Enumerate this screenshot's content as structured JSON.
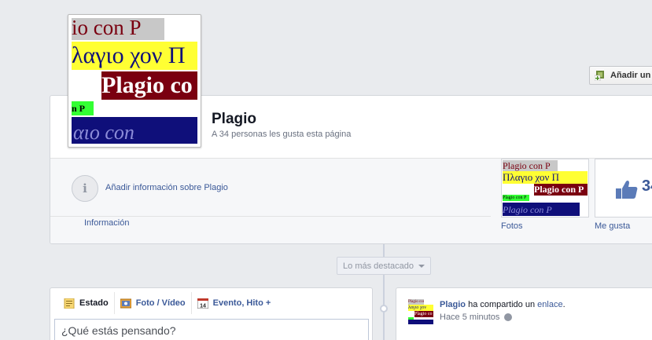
{
  "header": {
    "add_button_label": "Añadir un",
    "page_name": "Plagio",
    "likes_line": "A 34 personas les gusta esta página"
  },
  "profile_image": {
    "lines": [
      "io con P",
      "λαγιο χον Π",
      "Plagio co",
      "n P",
      "αιο con"
    ]
  },
  "info": {
    "add_info_link": "Añadir información sobre Plagio",
    "label": "Información"
  },
  "photos": {
    "label": "Fotos",
    "thumb_lines": [
      "Plagio con P",
      "Πλαγιο χον Π",
      "Plagio con P",
      "Plagio con P",
      "Plagio con P"
    ]
  },
  "likes": {
    "count": "34",
    "label": "Me gusta"
  },
  "timeline": {
    "highlight_label": "Lo más destacado"
  },
  "composer": {
    "tabs": [
      {
        "label": "Estado"
      },
      {
        "label": "Foto / Vídeo"
      },
      {
        "label": "Evento, Hito +"
      }
    ],
    "event_icon_day": "14",
    "placeholder": "¿Qué estás pensando?"
  },
  "post": {
    "author": "Plagio",
    "action_text": " ha compartido un ",
    "link_text": "enlace",
    "period": ".",
    "time": "Hace 5 minutos",
    "thumb_lines": [
      "Plagio con P",
      "λαγιο χον",
      "Plagio co"
    ]
  },
  "colors": {
    "link_blue": "#3b5998",
    "band_gray": "#c8c8c8",
    "band_yellow": "#ffff33",
    "band_maroon": "#7a0010",
    "band_green": "#33ff33",
    "band_navy": "#0f0f7a"
  }
}
